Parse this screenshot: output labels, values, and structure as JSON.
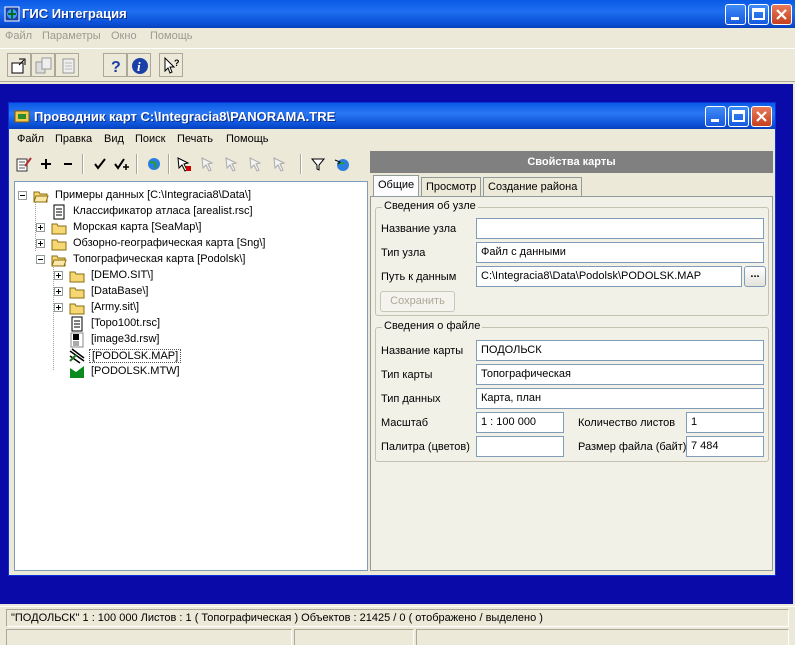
{
  "app": {
    "title": "ГИС Интеграция",
    "menu": [
      "Файл",
      "Параметры",
      "Окно",
      "Помощь"
    ]
  },
  "window": {
    "title": "Проводник карт C:\\Integracia8\\PANORAMA.TRE",
    "menu": [
      "Файл",
      "Правка",
      "Вид",
      "Поиск",
      "Печать",
      "Помощь"
    ]
  },
  "tree": {
    "root": "Примеры данных [C:\\Integracia8\\Data\\]",
    "classifier": "Классификатор атласа [arealist.rsc]",
    "sea": "Морская карта [SeaMap\\]",
    "overview": "Обзорно-географическая карта [Sng\\]",
    "topo": "Топографическая карта [Podolsk\\]",
    "demo": "[DEMO.SIT\\]",
    "database": "[DataBase\\]",
    "army": "[Army.sit\\]",
    "topo100": "[Topo100t.rsc]",
    "image3d": "[image3d.rsw]",
    "podolsk_map": "[PODOLSK.MAP]",
    "podolsk_mtw": "[PODOLSK.MTW]"
  },
  "props": {
    "header": "Свойства карты",
    "tabs": [
      "Общие",
      "Просмотр",
      "Создание района"
    ],
    "node_group": "Сведения об узле",
    "node_name_label": "Название узла",
    "node_name_value": "",
    "node_type_label": "Тип узла",
    "node_type_value": "Файл с данными",
    "path_label": "Путь к данным",
    "path_value": "C:\\Integracia8\\Data\\Podolsk\\PODOLSK.MAP",
    "browse_label": "...",
    "save_label": "Сохранить",
    "file_group": "Сведения о файле",
    "map_name_label": "Название карты",
    "map_name_value": "ПОДОЛЬСК",
    "map_type_label": "Тип карты",
    "map_type_value": "Топографическая",
    "data_type_label": "Тип данных",
    "data_type_value": "Карта, план",
    "scale_label": "Масштаб",
    "scale_value": "1 : 100 000",
    "sheets_label": "Количество листов",
    "sheets_value": "1",
    "palette_label": "Палитра (цветов)",
    "palette_value": "",
    "size_label": "Размер файла (байт)",
    "size_value": "7 484"
  },
  "status": {
    "line": "\"ПОДОЛЬСК\"   1 : 100 000   Листов : 1   ( Топографическая )    Объектов : 21425 / 0 ( отображено / выделено )"
  },
  "colors": {
    "titlebar": "#0a5ae6",
    "workspace": "#0a0aa8",
    "panel": "#ece9d8"
  }
}
